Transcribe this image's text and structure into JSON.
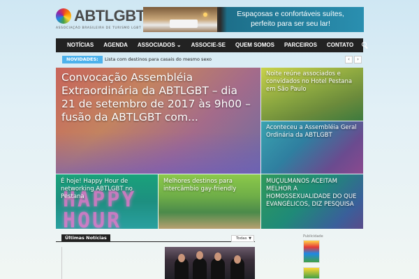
{
  "logo": {
    "name": "ABTLGBT",
    "tagline": "ASSOCIAÇÃO BRASILEIRA DE TURISMO LGBT"
  },
  "ad_banner": {
    "text_line1": "Espaçosas e confortáveis suítes,",
    "text_line2": "perfeito para ser seu lar!"
  },
  "nav": {
    "items": [
      "NOTÍCIAS",
      "AGENDA",
      "ASSOCIADOS ⌄",
      "ASSOCIE-SE",
      "QUEM SOMOS",
      "PARCEIROS",
      "CONTATO"
    ]
  },
  "ticker": {
    "label": "NOVIDADES:",
    "headline": "Lista com destinos para casais do mesmo sexo",
    "prev": "‹",
    "next": "›"
  },
  "featured": {
    "main": "Convocação Assembléia Extraordinária da ABTLGBT – dia 21 de setembro de 2017 às 9h00 – fusão da ABTLGBT com...",
    "top_right_1": "Noite reúne associados e convidados no Hotel Pestana em São Paulo",
    "top_right_2": "Aconteceu a Assembléia Geral Ordinária da ABTLGBT",
    "bottom_1": "É hoje! Happy Hour de networking ABTLGBT no Pestana",
    "bottom_1_neon": "HAPPY HOUR",
    "bottom_2": "Melhores destinos para intercâmbio gay-friendly",
    "bottom_3": "MUÇULMANOS ACEITAM MELHOR A HOMOSSEXUALIDADE DO QUE EVANGÉLICOS, DIZ PESQUISA"
  },
  "latest": {
    "title": "Últimas Notícias",
    "filter": "Todas"
  },
  "sidebar": {
    "ad_label": "Publicidade"
  },
  "colors": {
    "nav_bg": "#222222",
    "ticker_label": "#4db2ec"
  }
}
